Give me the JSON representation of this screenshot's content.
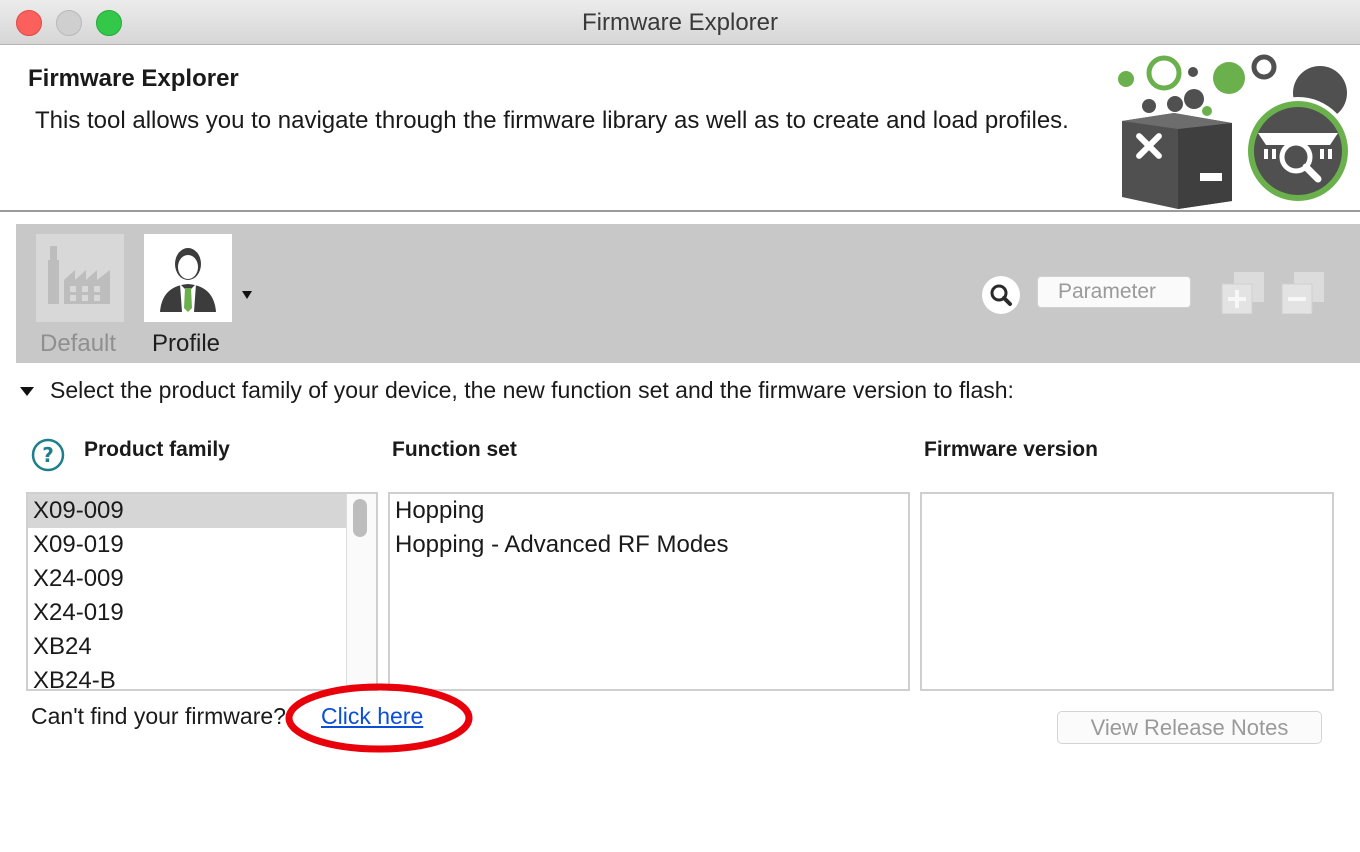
{
  "window": {
    "title": "Firmware Explorer"
  },
  "header": {
    "title": "Firmware Explorer",
    "description": "This tool allows you to navigate through the firmware library as well as to create and load profiles."
  },
  "toolbar": {
    "default_label": "Default",
    "profile_label": "Profile",
    "search": {
      "placeholder": "Parameter",
      "value": ""
    }
  },
  "section": {
    "text": "Select the product family of your device, the new function set and the firmware version to flash:"
  },
  "columns": {
    "product_family": "Product family",
    "function_set": "Function set",
    "firmware_version": "Firmware version"
  },
  "product_families": [
    "X09-009",
    "X09-019",
    "X24-009",
    "X24-019",
    "XB24",
    "XB24-B"
  ],
  "product_selected": "X09-009",
  "function_sets": [
    "Hopping",
    "Hopping - Advanced RF Modes"
  ],
  "firmware_versions": [],
  "footer": {
    "cant_find": "Can't find your firmware?",
    "click_here": "Click here",
    "release_notes": "View Release Notes"
  },
  "colors": {
    "brand_green": "#6ab04c",
    "annotation_red": "#e8000b",
    "link_blue": "#0b4fd6"
  }
}
